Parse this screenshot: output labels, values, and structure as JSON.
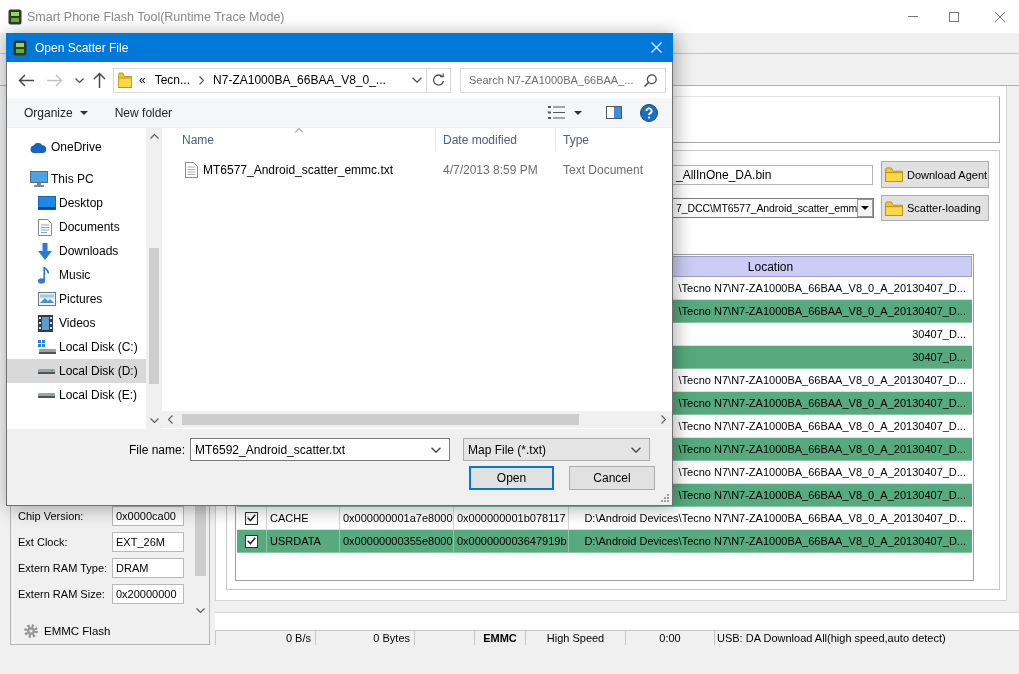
{
  "main_window": {
    "title": "Smart Phone Flash Tool(Runtime Trace Mode)",
    "download_agent": {
      "value": "_AllInOne_DA.bin",
      "button": "Download Agent"
    },
    "scatter_loading": {
      "value": "7_DCC\\MT6577_Android_scatter_emm",
      "button": "Scatter-loading"
    },
    "partition_table": {
      "columns": [
        "Location"
      ],
      "rows": [
        {
          "location": "\\Tecno N7\\N7-ZA1000BA_66BAA_V8_0_A_20130407_D..."
        },
        {
          "location": "\\Tecno N7\\N7-ZA1000BA_66BAA_V8_0_A_20130407_D..."
        },
        {
          "location": "30407_D..."
        },
        {
          "location": "30407_D..."
        },
        {
          "location": "\\Tecno N7\\N7-ZA1000BA_66BAA_V8_0_A_20130407_D..."
        },
        {
          "location": "\\Tecno N7\\N7-ZA1000BA_66BAA_V8_0_A_20130407_D..."
        },
        {
          "location": "\\Tecno N7\\N7-ZA1000BA_66BAA_V8_0_A_20130407_D..."
        },
        {
          "location": "\\Tecno N7\\N7-ZA1000BA_66BAA_V8_0_A_20130407_D..."
        },
        {
          "location": "\\Tecno N7\\N7-ZA1000BA_66BAA_V8_0_A_20130407_D..."
        },
        {
          "location": "\\Tecno N7\\N7-ZA1000BA_66BAA_V8_0_A_20130407_D..."
        },
        {
          "checked": true,
          "name": "CACHE",
          "begin_address": "0x000000001a7e8000",
          "end_address": "0x000000001b078117",
          "location": "D:\\Android Devices\\Tecno N7\\N7-ZA1000BA_66BAA_V8_0_A_20130407_D..."
        },
        {
          "checked": true,
          "name": "USRDATA",
          "begin_address": "0x00000000355e8000",
          "end_address": "0x000000003647919b",
          "location": "D:\\Android Devices\\Tecno N7\\N7-ZA1000BA_66BAA_V8_0_A_20130407_D..."
        }
      ]
    },
    "device_info": [
      {
        "label": "Chip Version:",
        "value": "0x0000ca00"
      },
      {
        "label": "Ext Clock:",
        "value": "EXT_26M"
      },
      {
        "label": "Extern RAM Type:",
        "value": "DRAM"
      },
      {
        "label": "Extern RAM Size:",
        "value": "0x20000000"
      }
    ],
    "storage_tab": "EMMC Flash",
    "progress": {
      "level": 0
    },
    "status_bar": {
      "speed": "0 B/s",
      "bytes": "0 Bytes",
      "storage": "EMMC",
      "speed_mode": "High Speed",
      "time": "0:00",
      "connection": "USB: DA Download All(high speed,auto detect)"
    }
  },
  "dialog": {
    "title": "Open Scatter File",
    "nav_buttons": [
      {
        "kind": "back",
        "disabled": false
      },
      {
        "kind": "forward",
        "disabled": true
      },
      {
        "kind": "recent",
        "disabled": false
      },
      {
        "kind": "up",
        "disabled": false
      }
    ],
    "address": {
      "overflow": "«",
      "path": [
        "Tecn...",
        "N7-ZA1000BA_66BAA_V8_0_..."
      ]
    },
    "search": {
      "placeholder": "Search N7-ZA1000BA_66BAA_..."
    },
    "toolbar": {
      "organize": "Organize",
      "new_folder": "New folder"
    },
    "navigation": [
      {
        "label": "OneDrive",
        "kind": "cloud",
        "selected": false
      },
      {
        "label": "This PC",
        "kind": "computer",
        "selected": false,
        "children": [
          {
            "label": "Desktop",
            "kind": "desktop",
            "selected": false
          },
          {
            "label": "Documents",
            "kind": "documents",
            "selected": false
          },
          {
            "label": "Downloads",
            "kind": "downloads",
            "selected": false
          },
          {
            "label": "Music",
            "kind": "music",
            "selected": false
          },
          {
            "label": "Pictures",
            "kind": "pictures",
            "selected": false
          },
          {
            "label": "Videos",
            "kind": "videos",
            "selected": false
          },
          {
            "label": "Local Disk (C:)",
            "kind": "system-disk",
            "selected": false
          },
          {
            "label": "Local Disk (D:)",
            "kind": "disk",
            "selected": true
          },
          {
            "label": "Local Disk (E:)",
            "kind": "disk",
            "selected": false
          }
        ]
      }
    ],
    "files": {
      "columns": [
        {
          "label": "Name",
          "sorted": true
        },
        {
          "label": "Date modified",
          "sorted": false
        },
        {
          "label": "Type",
          "sorted": false
        }
      ],
      "rows": [
        {
          "name": "MT6577_Android_scatter_emmc.txt",
          "date_modified": "4/7/2013 8:59 PM",
          "type": "Text Document"
        }
      ]
    },
    "file_name": {
      "label": "File name:",
      "value": "MT6592_Android_scatter.txt"
    },
    "file_type": "Map File (*.txt)",
    "buttons": [
      {
        "label": "Open",
        "default": true
      },
      {
        "label": "Cancel",
        "default": false
      }
    ]
  }
}
